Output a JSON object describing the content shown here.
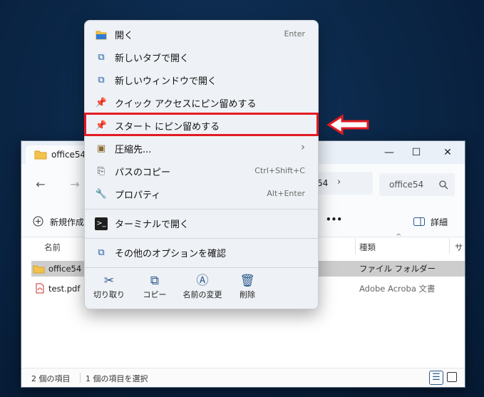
{
  "explorer": {
    "tab_title": "office54",
    "address_tail": "54",
    "search_placeholder": "office54",
    "new_button": "新規作成",
    "more": "•••",
    "details": "詳細",
    "columns": {
      "name": "名前",
      "type": "種類",
      "size": "サ"
    },
    "files": [
      {
        "name": "office54",
        "type": "ファイル フォルダー"
      },
      {
        "name": "test.pdf",
        "type": "Adobe Acroba 文書"
      }
    ],
    "status": {
      "count": "2 個の項目",
      "selected": "1 個の項目を選択"
    }
  },
  "menu": {
    "items": [
      {
        "label": "開く",
        "shortcut": "Enter"
      },
      {
        "label": "新しいタブで開く",
        "shortcut": ""
      },
      {
        "label": "新しいウィンドウで開く",
        "shortcut": ""
      },
      {
        "label": "クイック アクセスにピン留めする",
        "shortcut": ""
      },
      {
        "label": "スタート にピン留めする",
        "shortcut": ""
      },
      {
        "label": "圧縮先...",
        "shortcut": "›"
      },
      {
        "label": "パスのコピー",
        "shortcut": "Ctrl+Shift+C"
      },
      {
        "label": "プロパティ",
        "shortcut": "Alt+Enter"
      },
      {
        "label": "ターミナルで開く",
        "shortcut": ""
      },
      {
        "label": "その他のオプションを確認",
        "shortcut": ""
      }
    ],
    "actions": [
      "切り取り",
      "コピー",
      "名前の変更",
      "削除"
    ]
  }
}
